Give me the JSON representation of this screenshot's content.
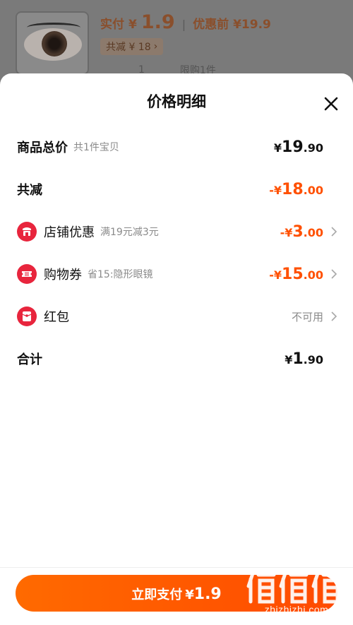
{
  "header": {
    "pay_label": "实付",
    "pay_yen": "¥",
    "pay_amount": "1.9",
    "divider": "|",
    "original_label": "优惠前",
    "original_price": "¥19.9",
    "reduce_tag": "共减 ¥ 18",
    "reduce_chevron": "›",
    "quantity": "1",
    "limit_text": "限购1件"
  },
  "sheet": {
    "title": "价格明细",
    "close_icon": "close-icon"
  },
  "rows": {
    "total": {
      "label": "商品总价",
      "sub": "共1件宝贝",
      "yen": "¥",
      "int": "19",
      "dec": ".90"
    },
    "reduce": {
      "label": "共减",
      "prefix": "-¥",
      "int": "18",
      "dec": ".00"
    },
    "shop": {
      "label": "店铺优惠",
      "sub": "满19元减3元",
      "prefix": "-¥",
      "int": "3",
      "dec": ".00",
      "icon": "shop-icon"
    },
    "coupon": {
      "label": "购物券",
      "sub": "省15:隐形眼镜",
      "prefix": "-¥",
      "int": "15",
      "dec": ".00",
      "icon": "ticket-icon"
    },
    "redpacket": {
      "label": "红包",
      "value": "不可用",
      "icon": "red-packet-icon"
    },
    "sum": {
      "label": "合计",
      "yen": "¥",
      "int": "1",
      "dec": ".90"
    }
  },
  "footer": {
    "button_label": "立即支付",
    "button_yen": "¥",
    "button_amount": "1.9"
  },
  "watermark": {
    "text": "zhizhizhi.com",
    "logo": "值值值"
  },
  "colors": {
    "accent": "#ff5000",
    "icon_red": "#e8253d"
  }
}
